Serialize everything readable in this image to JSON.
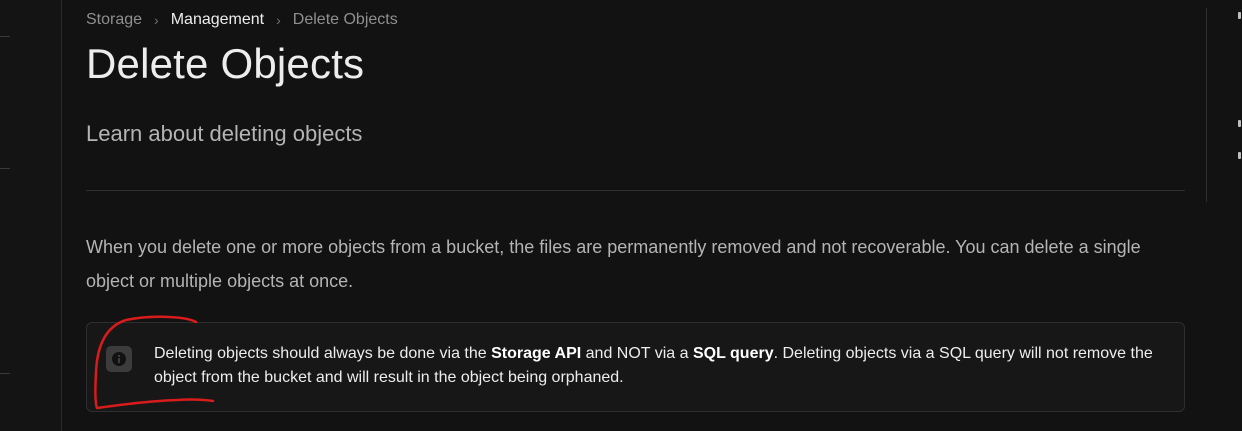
{
  "breadcrumb": {
    "items": [
      "Storage",
      "Management",
      "Delete Objects"
    ],
    "separator": "›"
  },
  "header": {
    "title": "Delete Objects",
    "subtitle": "Learn about deleting objects"
  },
  "content": {
    "paragraph": "When you delete one or more objects from a bucket, the files are permanently removed and not recoverable. You can delete a single object or multiple objects at once."
  },
  "callout": {
    "icon": "info-icon",
    "text_part1": "Deleting objects should always be done via the ",
    "bold1": "Storage API",
    "text_part2": " and NOT via a ",
    "bold2": "SQL query",
    "text_part3": ". Deleting objects via a SQL query will not remove the object from the bucket and will result in the object being orphaned."
  },
  "colors": {
    "background": "#121212",
    "text_primary": "#ededed",
    "text_secondary": "#b4b4b4",
    "annotation": "#d81b1b"
  }
}
